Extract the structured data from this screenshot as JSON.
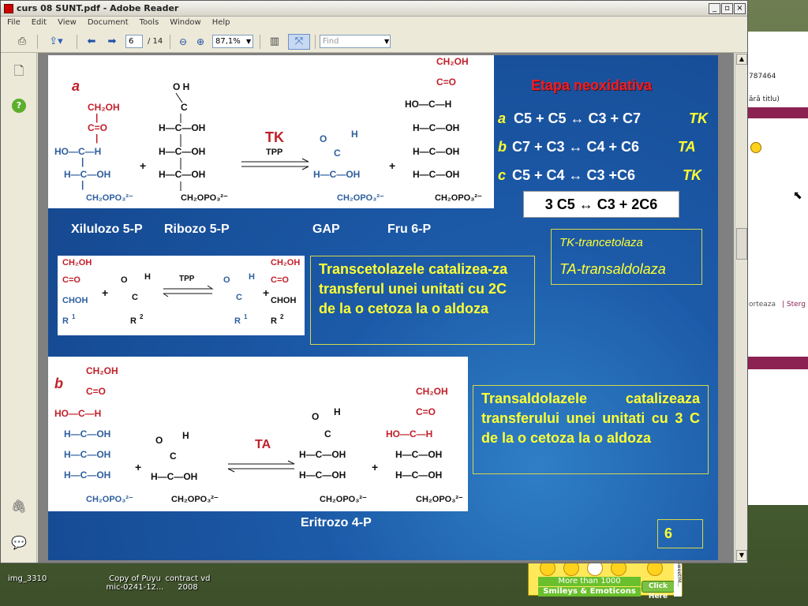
{
  "app": {
    "title": "curs 08 SUNT.pdf - Adobe Reader",
    "menu": [
      "File",
      "Edit",
      "View",
      "Document",
      "Tools",
      "Window",
      "Help"
    ],
    "page_current": "6",
    "page_total": "/ 14",
    "zoom": "87,1%",
    "find_placeholder": "Find"
  },
  "background_window": {
    "text_1": "787464",
    "text_2": "ără titlu)",
    "text_3": "orteaza",
    "text_4": "| Sterg"
  },
  "desktop": {
    "icons": [
      {
        "label": "img_3310"
      },
      {
        "label": "Copy of Puyu\nmic-0241-12..."
      },
      {
        "label": "contract vd\n2008"
      }
    ],
    "ad": {
      "line1": "More than 1000",
      "line2": "Smileys & Emoticons",
      "button": "Click Here",
      "side": "Sweet!M..."
    }
  },
  "slide": {
    "panel_a_letter": "a",
    "panel_b_letter": "b",
    "enzyme_tk": "TK",
    "cofactor_tpp": "TPP",
    "enzyme_ta": "TA",
    "labels": {
      "xilulozo": "Xilulozo 5-P",
      "ribozo": "Ribozo 5-P",
      "gap": "GAP",
      "fru": "Fru 6-P",
      "eritrozo": "Eritrozo 4-P"
    },
    "heading": "Etapa neoxidativa",
    "equations": [
      {
        "tag": "a",
        "text": "C5 + C5 ↔ C3 + C7",
        "enzyme": "TK"
      },
      {
        "tag": "b",
        "text": "C7 + C3 ↔ C4 + C6",
        "enzyme": "TA"
      },
      {
        "tag": "c",
        "text": "C5 + C4 ↔ C3 +C6",
        "enzyme": "TK"
      }
    ],
    "sum": "3 C5 ↔ C3 + 2C6",
    "abbrev_tk": "TK-trancetolaza",
    "abbrev_ta": "TA-transaldolaza",
    "tk_note": "Transcetolazele catalizea-za transferul unei unitati cu 2C de la o cetoza la o aldoza",
    "ta_note": "Transaldolazele catalizeaza transferului unei unitati cu 3 C de la o cetoza la o aldoza",
    "page_number": "6",
    "general_labels": {
      "r1": "R",
      "r2": "R",
      "choh": "CHOH"
    }
  }
}
